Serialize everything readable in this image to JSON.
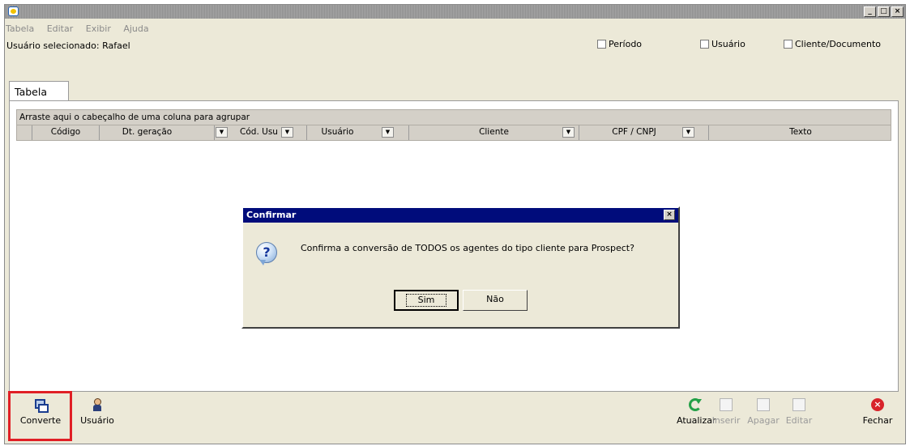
{
  "window": {
    "title": "",
    "controls": {
      "minimize": "_",
      "maximize": "□",
      "close": "×"
    }
  },
  "menu": [
    "Tabela",
    "Editar",
    "Exibir",
    "Ajuda"
  ],
  "header": {
    "selected_user": "Usuário selecionado: Rafael",
    "filters": [
      "Período",
      "Usuário",
      "Cliente/Documento"
    ]
  },
  "tabs": [
    "Tabela"
  ],
  "grid": {
    "group_hint": "Arraste aqui o cabeçalho de uma coluna para agrupar",
    "columns": [
      "Código",
      "Dt. geração",
      "Cód. Usu",
      "Usuário",
      "Cliente",
      "CPF / CNPJ",
      "Texto"
    ]
  },
  "dialog": {
    "title": "Confirmar",
    "message": "Confirma a conversão de TODOS os agentes do tipo cliente para Prospect?",
    "yes": "Sim",
    "no": "Não",
    "icon": "question-icon",
    "close": "×"
  },
  "toolbar": {
    "left": [
      {
        "label": "Converte",
        "icon": "convert-icon",
        "enabled": true
      },
      {
        "label": "Usuário",
        "icon": "user-icon",
        "enabled": true
      }
    ],
    "right": [
      {
        "label": "Atualizar",
        "icon": "refresh-icon",
        "enabled": true
      },
      {
        "label": "Inserir",
        "icon": "insert-icon",
        "enabled": false
      },
      {
        "label": "Apagar",
        "icon": "delete-icon",
        "enabled": false
      },
      {
        "label": "Editar",
        "icon": "edit-icon",
        "enabled": false
      },
      {
        "label": "Fechar",
        "icon": "close-icon",
        "enabled": true
      }
    ]
  },
  "colors": {
    "dialog_title_bg": "#000c7b",
    "highlight": "#e01f25",
    "refresh": "#23a047",
    "close": "#d8232a"
  }
}
